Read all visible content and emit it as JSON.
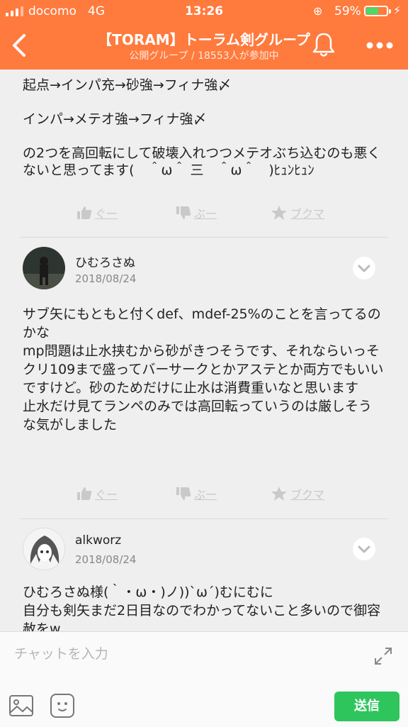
{
  "status_bar": {
    "carrier": "docomo",
    "network": "4G",
    "time": "13:26",
    "battery": "59%"
  },
  "header": {
    "title": "【TORAM】トーラム剣グループ",
    "subtitle": "公開グループ / 18553人が参加中"
  },
  "posts": [
    {
      "text": "起点→インパ充→砂強→フィナ強〆\n\nインパ→メテオ強→フィナ強〆\n\nの2つを高回転にして破壊入れつつメテオぶち込むのも悪くないと思ってます(　＾ω＾ 三　＾ω＾　)ﾋｭﾝﾋｭﾝ",
      "actions": {
        "good": "ぐー",
        "boo": "ぶー",
        "bookmark": "ブクマ"
      }
    },
    {
      "author": "ひむろさぬ",
      "date": "2018/08/24",
      "text": "サブ矢にもともと付くdef、mdef-25%のことを言ってるのかな\nmp問題は止水挟むから砂がきつそうです、それならいっそクリ109まで盛ってバーサークとかアステとか両方でもいいですけど。砂のためだけに止水は消費重いなと思います\n止水だけ見てランペのみでは高回転っていうのは厳しそうな気がしました",
      "actions": {
        "good": "ぐー",
        "boo": "ぶー",
        "bookmark": "ブクマ"
      }
    },
    {
      "author": "alkworz",
      "date": "2018/08/24",
      "text": "ひむろさぬ様(｀・ω・)ノ))`ω´)むにむに\n自分も剣矢まだ2日目なのでわかってないこと多いので御容赦をw"
    }
  ],
  "input": {
    "placeholder": "チャットを入力",
    "send_label": "送信"
  }
}
